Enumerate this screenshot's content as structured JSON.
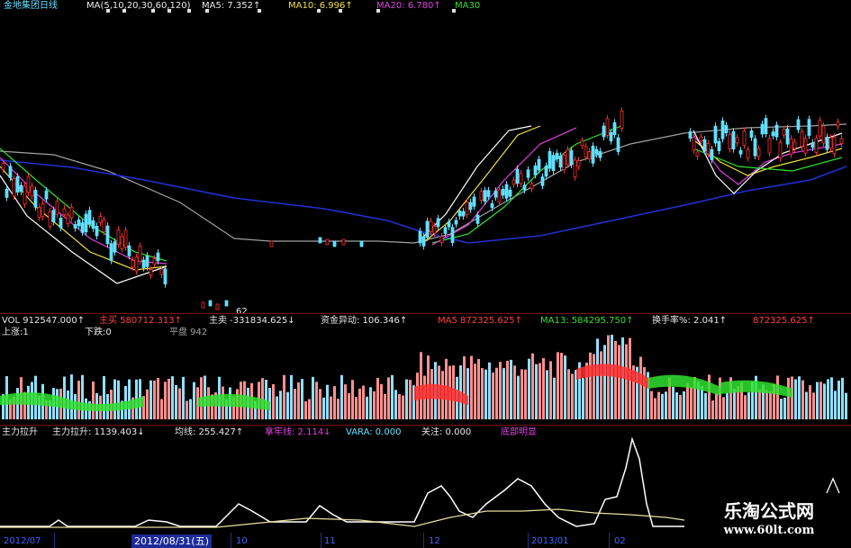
{
  "header": {
    "stock_name": "金地集团日线",
    "ma_params": "MA(5,10,20,30,60,120)",
    "ma5": "MA5: 7.352↑",
    "ma10": "MA10: 6.996↑",
    "ma20": "MA20: 6.780↑",
    "ma30": "MA30"
  },
  "price_panel": {
    "low_marker": "62"
  },
  "volume_panel": {
    "vol": "VOL 912547.000↑",
    "buy": "主买 580712.313↑",
    "sell": "主卖 -331834.625↓",
    "fund_flow": "资金异动: 106.346↑",
    "ma5": "MA5 872325.625↑",
    "ma13": "MA13: 584295.750↑",
    "turnover": "换手率%: 2.041↑",
    "extra": "872325.625↑",
    "up": "上涨:1",
    "down": "下跌:0",
    "flat": "平盘 942"
  },
  "indicator_panel": {
    "name": "主力拉升",
    "value": "主力拉升: 1139.403↓",
    "avg": "均线: 255.427↑",
    "rate": "拿牢线: 2.114↓",
    "vara": "VARA: 0.000",
    "focus": "关注: 0.000",
    "bottom": "底部明显"
  },
  "dates": {
    "d1": "2012/07",
    "selected": "2012/08/31(五)",
    "d3": "10",
    "d4": "11",
    "d5": "12",
    "d6": "2013/01",
    "d7": "02"
  },
  "watermark": {
    "line1": "乐淘公式网",
    "line2": "www.60lt.com"
  },
  "colors": {
    "up": "#ff3030",
    "down": "#60e0ff",
    "ma5": "#ffffff",
    "ma10": "#f0e040",
    "ma20": "#e040e0",
    "ma30": "#30e030",
    "ma60": "#a0a0a0",
    "ma120": "#2030d0"
  },
  "chart_data": [
    {
      "type": "line",
      "title": "金地集团日线",
      "series": [
        {
          "name": "MA5",
          "values": [
            6.0,
            5.9,
            5.7,
            5.6,
            5.5,
            5.4,
            5.5,
            5.6,
            5.7,
            5.9,
            6.2,
            6.6,
            6.9,
            7.1,
            7.2,
            7.3,
            7.35
          ]
        },
        {
          "name": "MA10",
          "values": [
            6.1,
            6.0,
            5.8,
            5.7,
            5.6,
            5.5,
            5.5,
            5.5,
            5.6,
            5.7,
            6.0,
            6.3,
            6.6,
            6.8,
            6.9,
            7.0,
            7.0
          ]
        },
        {
          "name": "MA20",
          "values": [
            6.3,
            6.2,
            6.0,
            5.8,
            5.7,
            5.6,
            5.5,
            5.5,
            5.5,
            5.6,
            5.8,
            6.1,
            6.4,
            6.6,
            6.7,
            6.75,
            6.78
          ]
        }
      ]
    },
    {
      "type": "bar",
      "title": "VOL",
      "values": [
        912547.0
      ]
    },
    {
      "type": "line",
      "title": "主力拉升",
      "series": [
        {
          "name": "主力拉升",
          "values": [
            0,
            0,
            30,
            0,
            50,
            0,
            200,
            150,
            250,
            600,
            400,
            700,
            300,
            1100,
            0
          ]
        },
        {
          "name": "均线",
          "values": [
            0,
            0,
            10,
            10,
            20,
            30,
            80,
            100,
            150,
            220,
            230,
            240,
            240,
            255,
            255
          ]
        }
      ]
    }
  ]
}
